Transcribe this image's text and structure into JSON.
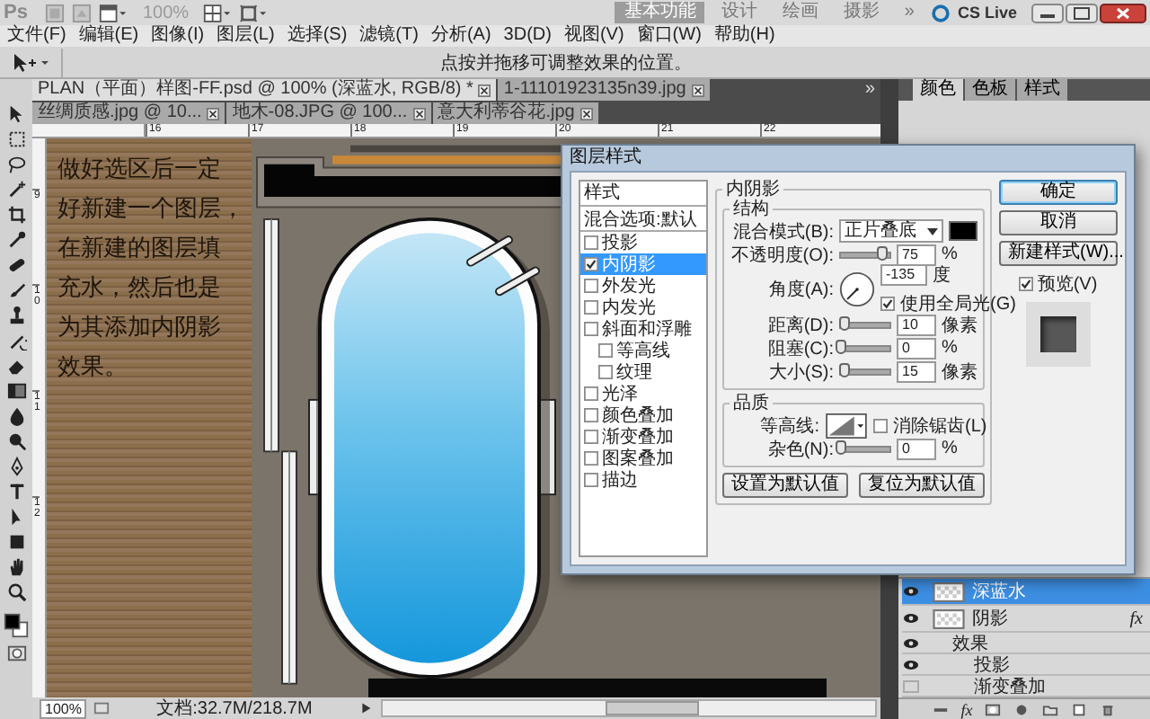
{
  "app_bar": {
    "logo": "Ps",
    "zoom": "100%",
    "workspaces": [
      {
        "label": "基本功能",
        "selected": true
      },
      {
        "label": "设计",
        "selected": false
      },
      {
        "label": "绘画",
        "selected": false
      },
      {
        "label": "摄影",
        "selected": false
      }
    ],
    "more": "»",
    "cs_live": "CS Live"
  },
  "menu": [
    "文件(F)",
    "编辑(E)",
    "图像(I)",
    "图层(L)",
    "选择(S)",
    "滤镜(T)",
    "分析(A)",
    "3D(D)",
    "视图(V)",
    "窗口(W)",
    "帮助(H)"
  ],
  "options_bar": {
    "hint": "点按并拖移可调整效果的位置。"
  },
  "document_tabs": [
    {
      "label": "PLAN（平面）样图-FF.psd @ 100% (深蓝水, RGB/8) *",
      "selected": true
    },
    {
      "label": "1-11101923135n39.jpg",
      "selected": false
    },
    {
      "label": "丝绸质感.jpg @ 10...",
      "selected": false
    },
    {
      "label": "地木-08.JPG @ 100...",
      "selected": false
    },
    {
      "label": "意大利蒂谷花.jpg",
      "selected": false
    }
  ],
  "tabs_more": "»",
  "rulers": {
    "horizontal": [
      "16",
      "17",
      "18",
      "19",
      "20",
      "21",
      "22"
    ],
    "vertical": [
      "9",
      "10",
      "11",
      "12"
    ]
  },
  "canvas": {
    "note_lines": [
      "做好选区后一定",
      "好新建一个图层，",
      "在新建的图层填",
      "充水，然后也是",
      "为其添加内阴影",
      "效果。"
    ]
  },
  "status_bar": {
    "zoom": "100%",
    "document": "文档:32.7M/218.7M"
  },
  "panel_tabs": [
    {
      "label": "颜色",
      "selected": true
    },
    {
      "label": "色板",
      "selected": false
    },
    {
      "label": "样式",
      "selected": false
    }
  ],
  "layers": [
    {
      "name": "深蓝水",
      "selected": true,
      "visible": true
    },
    {
      "name": "阴影",
      "selected": false,
      "visible": true,
      "fx": "fx",
      "children": [
        {
          "name": "效果",
          "visible": true,
          "children": [
            {
              "name": "投影",
              "visible": true
            },
            {
              "name": "渐变叠加",
              "visible": false
            }
          ]
        }
      ]
    }
  ],
  "layers_footer": {
    "fx": "fx"
  },
  "dialog": {
    "title": "图层样式",
    "styles_header": "样式",
    "styles": [
      {
        "label": "混合选项:默认",
        "kind": "option",
        "selected": false
      },
      {
        "label": "投影",
        "kind": "check",
        "checked": false,
        "selected": false
      },
      {
        "label": "内阴影",
        "kind": "check",
        "checked": true,
        "selected": true
      },
      {
        "label": "外发光",
        "kind": "check",
        "checked": false,
        "selected": false
      },
      {
        "label": "内发光",
        "kind": "check",
        "checked": false,
        "selected": false
      },
      {
        "label": "斜面和浮雕",
        "kind": "check",
        "checked": false,
        "selected": false
      },
      {
        "label": "等高线",
        "kind": "sub",
        "checked": false,
        "selected": false
      },
      {
        "label": "纹理",
        "kind": "sub",
        "checked": false,
        "selected": false
      },
      {
        "label": "光泽",
        "kind": "check",
        "checked": false,
        "selected": false
      },
      {
        "label": "颜色叠加",
        "kind": "check",
        "checked": false,
        "selected": false
      },
      {
        "label": "渐变叠加",
        "kind": "check",
        "checked": false,
        "selected": false
      },
      {
        "label": "图案叠加",
        "kind": "check",
        "checked": false,
        "selected": false
      },
      {
        "label": "描边",
        "kind": "check",
        "checked": false,
        "selected": false
      }
    ],
    "section_title": "内阴影",
    "structure": {
      "title": "结构",
      "blend_label": "混合模式(B):",
      "blend_mode": "正片叠底",
      "rows": [
        {
          "kind": "slider",
          "label": "不透明度(O):",
          "level": 0.85,
          "value": "75",
          "unit": "%"
        },
        {
          "kind": "angle",
          "label": "角度(A):",
          "value": "-135",
          "unit": "度",
          "global_label": "使用全局光(G)",
          "global": true
        },
        {
          "kind": "slider",
          "label": "距离(D):",
          "level": 0.07,
          "value": "10",
          "unit": "像素"
        },
        {
          "kind": "slider",
          "label": "阻塞(C):",
          "level": 0,
          "value": "0",
          "unit": "%"
        },
        {
          "kind": "slider",
          "label": "大小(S):",
          "level": 0.07,
          "value": "15",
          "unit": "像素"
        }
      ]
    },
    "quality": {
      "title": "品质",
      "contour_label": "等高线:",
      "anti_alias_label": "消除锯齿(L)",
      "anti_alias": false,
      "noise": {
        "label": "杂色(N):",
        "level": 0,
        "value": "0",
        "unit": "%"
      }
    },
    "default_buttons": [
      "设置为默认值",
      "复位为默认值"
    ],
    "buttons": [
      {
        "label": "确定",
        "primary": true
      },
      {
        "label": "取消",
        "primary": false
      },
      {
        "label": "新建样式(W)...",
        "primary": false
      }
    ],
    "preview_label": "预览(V)",
    "preview": true
  }
}
